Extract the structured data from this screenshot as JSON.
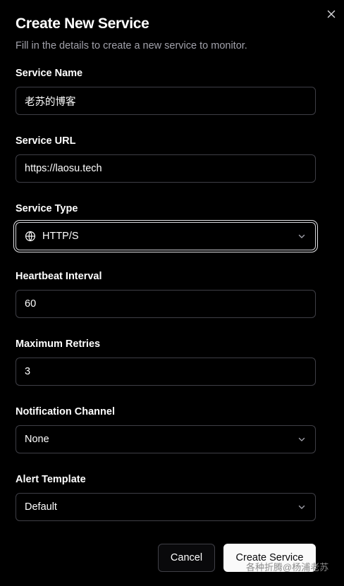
{
  "dialog": {
    "title": "Create New Service",
    "subtitle": "Fill in the details to create a new service to monitor."
  },
  "form": {
    "service_name": {
      "label": "Service Name",
      "value": "老苏的博客"
    },
    "service_url": {
      "label": "Service URL",
      "value": "https://laosu.tech"
    },
    "service_type": {
      "label": "Service Type",
      "value": "HTTP/S",
      "icon": "globe-icon"
    },
    "heartbeat_interval": {
      "label": "Heartbeat Interval",
      "value": "60"
    },
    "maximum_retries": {
      "label": "Maximum Retries",
      "value": "3"
    },
    "notification_channel": {
      "label": "Notification Channel",
      "value": "None"
    },
    "alert_template": {
      "label": "Alert Template",
      "value": "Default"
    }
  },
  "actions": {
    "cancel_label": "Cancel",
    "create_label": "Create Service"
  },
  "watermark": "各种折腾@杨浦老苏",
  "colors": {
    "background": "#000000",
    "border": "#3f3f46",
    "muted_text": "#a1a1aa",
    "primary_button": "#fafafa"
  }
}
